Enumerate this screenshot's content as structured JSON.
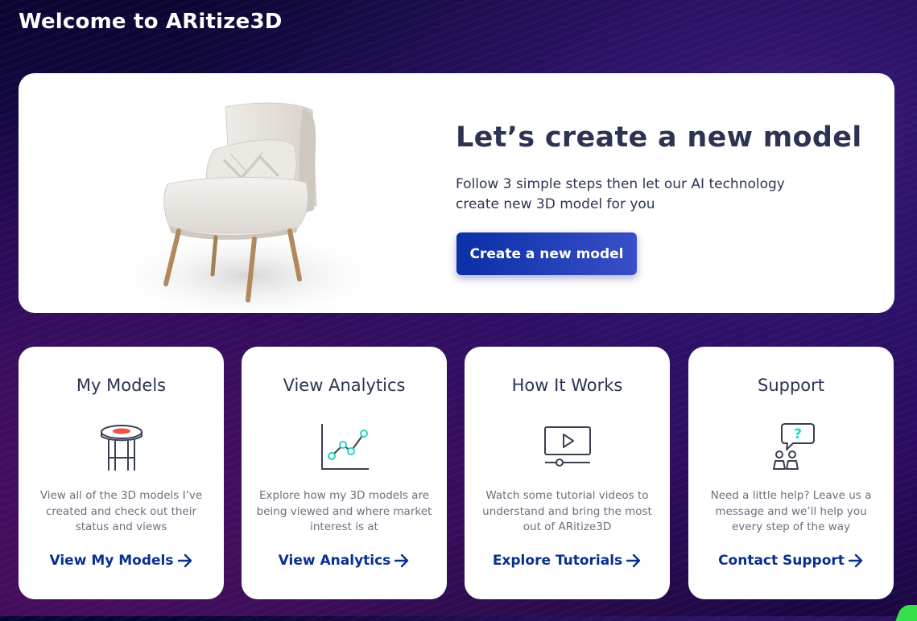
{
  "header": {
    "title": "Welcome to ARitize3D"
  },
  "hero": {
    "title": "Let’s create a new model",
    "subtitle": "Follow 3 simple steps then let our AI technology create new 3D model for you",
    "button_label": "Create a new model",
    "image": "armchair-with-pillow"
  },
  "cards": [
    {
      "title": "My Models",
      "icon": "side-table-icon",
      "description": "View all of the 3D models I’ve created and check out their status and views",
      "link_label": "View My Models"
    },
    {
      "title": "View Analytics",
      "icon": "line-chart-icon",
      "description": "Explore how my 3D models are being viewed and where market interest is at",
      "link_label": "View Analytics"
    },
    {
      "title": "How It Works",
      "icon": "video-player-icon",
      "description": "Watch some tutorial videos to understand and bring the most out of ARitize3D",
      "link_label": "Explore Tutorials"
    },
    {
      "title": "Support",
      "icon": "support-chat-icon",
      "description": "Need a little help? Leave us a message and we’ll help you every step of the way",
      "link_label": "Contact Support"
    }
  ],
  "colors": {
    "primary": "#0a2f8f",
    "button_gradient_start": "#0a2fa6",
    "button_gradient_end": "#3a4fc8",
    "heading": "#2c3452",
    "icon_accent_teal": "#2ad4c0",
    "icon_accent_red": "#f0504a"
  }
}
